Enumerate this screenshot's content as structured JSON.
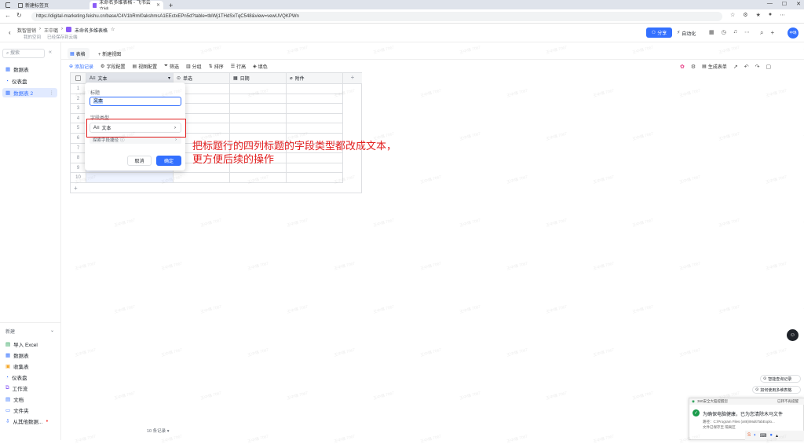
{
  "browser": {
    "tabs": [
      {
        "label": "新建标签页"
      },
      {
        "label": "未命名多维表格 - 飞书云文档"
      }
    ],
    "url": "https://digital-marketing.feishu.cn/base/C4V1bRmI0akshmsA1EEctxEPn5d?table=tblWj1THdSxTqC548&view=vewUVQKPWn"
  },
  "header": {
    "breadcrumb": [
      "数智营销",
      "王中璐"
    ],
    "doc_title": "未命名多维表格",
    "subtitle": "我的空间",
    "save_status": "已经保存到云端",
    "share_label": "分享",
    "automation_label": "自动化",
    "avatar_text": "中璐"
  },
  "sidebar": {
    "search_placeholder": "搜索",
    "items": [
      {
        "label": "数据表"
      },
      {
        "label": "仪表盘"
      },
      {
        "label": "数据表 2"
      }
    ],
    "new_label": "新建",
    "create_items": [
      {
        "label": "导入 Excel"
      },
      {
        "label": "数据表"
      },
      {
        "label": "收集表"
      },
      {
        "label": "仪表盘"
      },
      {
        "label": "工作流"
      },
      {
        "label": "文档"
      },
      {
        "label": "文件夹"
      },
      {
        "label": "从其他数据..."
      }
    ]
  },
  "views": {
    "grid_tab": "表格",
    "new_view": "新建视图"
  },
  "toolbar": {
    "add_record": "添加记录",
    "field_config": "字段配置",
    "view_config": "视图配置",
    "filter": "筛选",
    "group": "分组",
    "sort": "排序",
    "row_height": "行高",
    "fill_color": "填色",
    "generate_form": "生成表单"
  },
  "table": {
    "columns": [
      "文本",
      "单选",
      "日期",
      "附件"
    ],
    "rows": [
      "1",
      "2",
      "3",
      "4",
      "5",
      "6",
      "7",
      "8",
      "9",
      "10"
    ],
    "record_count": "10 条记录"
  },
  "popup": {
    "title_label": "标题",
    "title_value": "文本",
    "type_label": "字段类型",
    "type_value": "文本",
    "explore_label": "探索字段捷径",
    "cancel": "取消",
    "confirm": "确定"
  },
  "annotation": {
    "line1": "把标题行的四列标题的字段类型都改成文本，",
    "line2": "更方便后续的操作"
  },
  "right_actions": {
    "smart_query": "智能查询记录",
    "howto": "如何使用多维表格"
  },
  "notification": {
    "header": "360安全大脑提醒您",
    "right_text": "已转不再提醒",
    "message": "为确保电脑健康，已为您清除木马文件",
    "path_label": "路径：C:\\Program Files (x86)\\MultiTabExplo...",
    "footer": "文件已保存至 隔离区"
  },
  "watermark": "王中璐 7067"
}
